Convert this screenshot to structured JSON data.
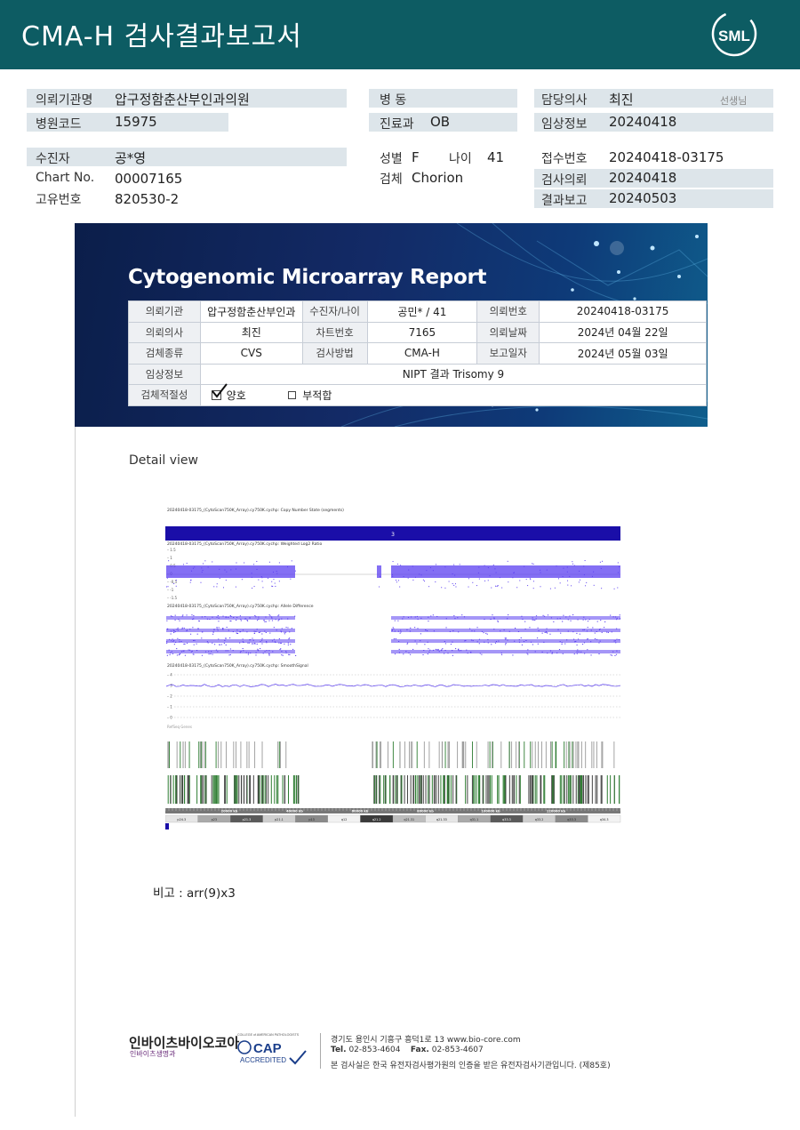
{
  "header": {
    "title": "CMA-H 검사결과보고서",
    "logo_text": "SML"
  },
  "info": {
    "institution_label": "의뢰기관명",
    "institution": "압구정함춘산부인과의원",
    "hospital_code_label": "병원코드",
    "hospital_code": "15975",
    "patient_label": "수진자",
    "patient": "공*영",
    "chart_label": "Chart No.",
    "chart_no": "00007165",
    "id_label": "고유번호",
    "id_no": "820530-2",
    "ward_label": "병 동",
    "ward": "",
    "dept_label": "진료과",
    "dept": "OB",
    "sex_label": "성별",
    "sex": "F",
    "age_label": "나이",
    "age": "41",
    "specimen_label": "검체",
    "specimen": "Chorion",
    "doctor_label": "담당의사",
    "doctor": "최진",
    "doctor_suffix": "선생님",
    "clinical_label": "임상정보",
    "clinical": "20240418",
    "receipt_label": "접수번호",
    "receipt": "20240418-03175",
    "request_label": "검사의뢰",
    "request": "20240418",
    "result_label": "결과보고",
    "result": "20240503"
  },
  "report": {
    "title": "Cytogenomic Microarray Report",
    "rows": [
      {
        "h1": "의뢰기관",
        "v1": "압구정함춘산부인과",
        "h2": "수진자/나이",
        "v2": "공민* / 41",
        "h3": "의뢰번호",
        "v3": "20240418-03175"
      },
      {
        "h1": "의뢰의사",
        "v1": "최진",
        "h2": "차트번호",
        "v2": "7165",
        "h3": "의뢰날짜",
        "v3": "2024년 04월 22일"
      },
      {
        "h1": "검체종류",
        "v1": "CVS",
        "h2": "검사방법",
        "v2": "CMA-H",
        "h3": "보고일자",
        "v3": "2024년 05월 03일"
      }
    ],
    "clinical_label": "임상정보",
    "clinical_value": "NIPT 결과 Trisomy 9",
    "adequacy_label": "검체적절성",
    "adequacy_good": "양호",
    "adequacy_bad": "부적합"
  },
  "detail_label": "Detail view",
  "plot": {
    "track1": "20240418-03175_(CytoScan750K_Array).cy750K.cychp: Copy Number State (segments)",
    "state_value": "3",
    "track2": "20240418-03175_(CytoScan750K_Array).cy750K.cychp: Weighted Log2 Ratio",
    "y2_ticks": [
      "1.5",
      "1",
      "0.5",
      "0",
      "-0.5",
      "-1",
      "-1.5"
    ],
    "track3": "20240418-03175_(CytoScan750K_Array).cy750K.cychp: Allele Difference",
    "track4": "20240418-03175_(CytoScan750K_Array).cy750K.cychp: SmoothSignal",
    "y4_ticks": [
      "4",
      "3",
      "2",
      "1",
      "0"
    ],
    "genes_label": "RefSeq Genes",
    "scale_ticks": [
      "20000 kb",
      "40000 kb",
      "60000 kb",
      "80000 kb",
      "100000 kb",
      "120000 kb"
    ],
    "bands": [
      "p24.3",
      "p23",
      "p21.3",
      "p21.1",
      "p13",
      "q12",
      "q21.2",
      "q21.31",
      "q21.33",
      "q31.1",
      "q33.3",
      "q33.2",
      "q33.3",
      "q34.3"
    ]
  },
  "remark": "비고 : arr(9)x3",
  "footer": {
    "brand": "인바이츠바이오코아",
    "brand_sub": "인바이츠생명과",
    "cap_top": "COLLEGE of AMERICAN PATHOLOGISTS",
    "cap_text": "CAP",
    "cap_accredited": "ACCREDITED",
    "address": "경기도 용인시 기흥구 흥덕1로 13   www.bio-core.com",
    "tel_label": "Tel.",
    "tel": "02-853-4604",
    "fax_label": "Fax.",
    "fax": "02-853-4607",
    "notice": "본 검사실은 한국 유전자검사평가원의 인증을 받은 유전자검사기관입니다. (제85호)"
  },
  "colors": {
    "header_bg": "#0d5c63",
    "plot_signal": "#5b3ff0",
    "state_bar": "#1a0ea8",
    "gene_green": "#2e7d32"
  }
}
